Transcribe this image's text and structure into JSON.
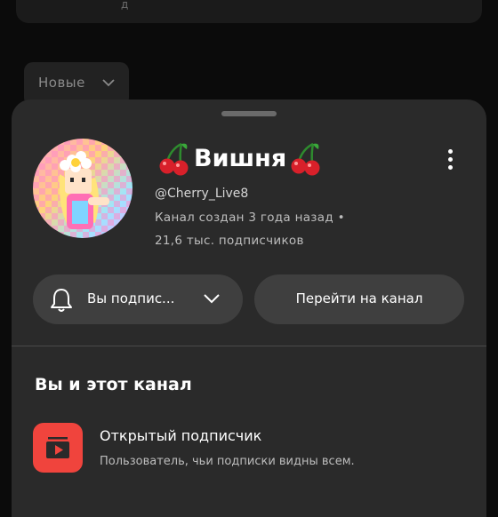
{
  "background_list": {
    "filter_chip": {
      "label": "Новые"
    }
  },
  "channel": {
    "name": "Вишня",
    "handle": "@Cherry_Live8",
    "created": "Канал создан 3 года назад •",
    "subscribers": "21,6 тыс. подписчиков"
  },
  "actions": {
    "subscribed_label": "Вы подпис...",
    "go_to_channel_label": "Перейти на канал"
  },
  "section": {
    "title": "Вы и этот канал"
  },
  "badge": {
    "title": "Открытый подписчик",
    "description": "Пользователь, чьи подписки видны всем."
  },
  "colors": {
    "sheet_bg": "#2a2a2a",
    "button_bg": "#3f3f3f",
    "badge_red": "#f0443d",
    "cherry_red": "#d8202a"
  },
  "icons": [
    "cherry-icon",
    "more-vert-icon",
    "bell-icon",
    "chevron-down-icon",
    "playlist-play-icon"
  ]
}
